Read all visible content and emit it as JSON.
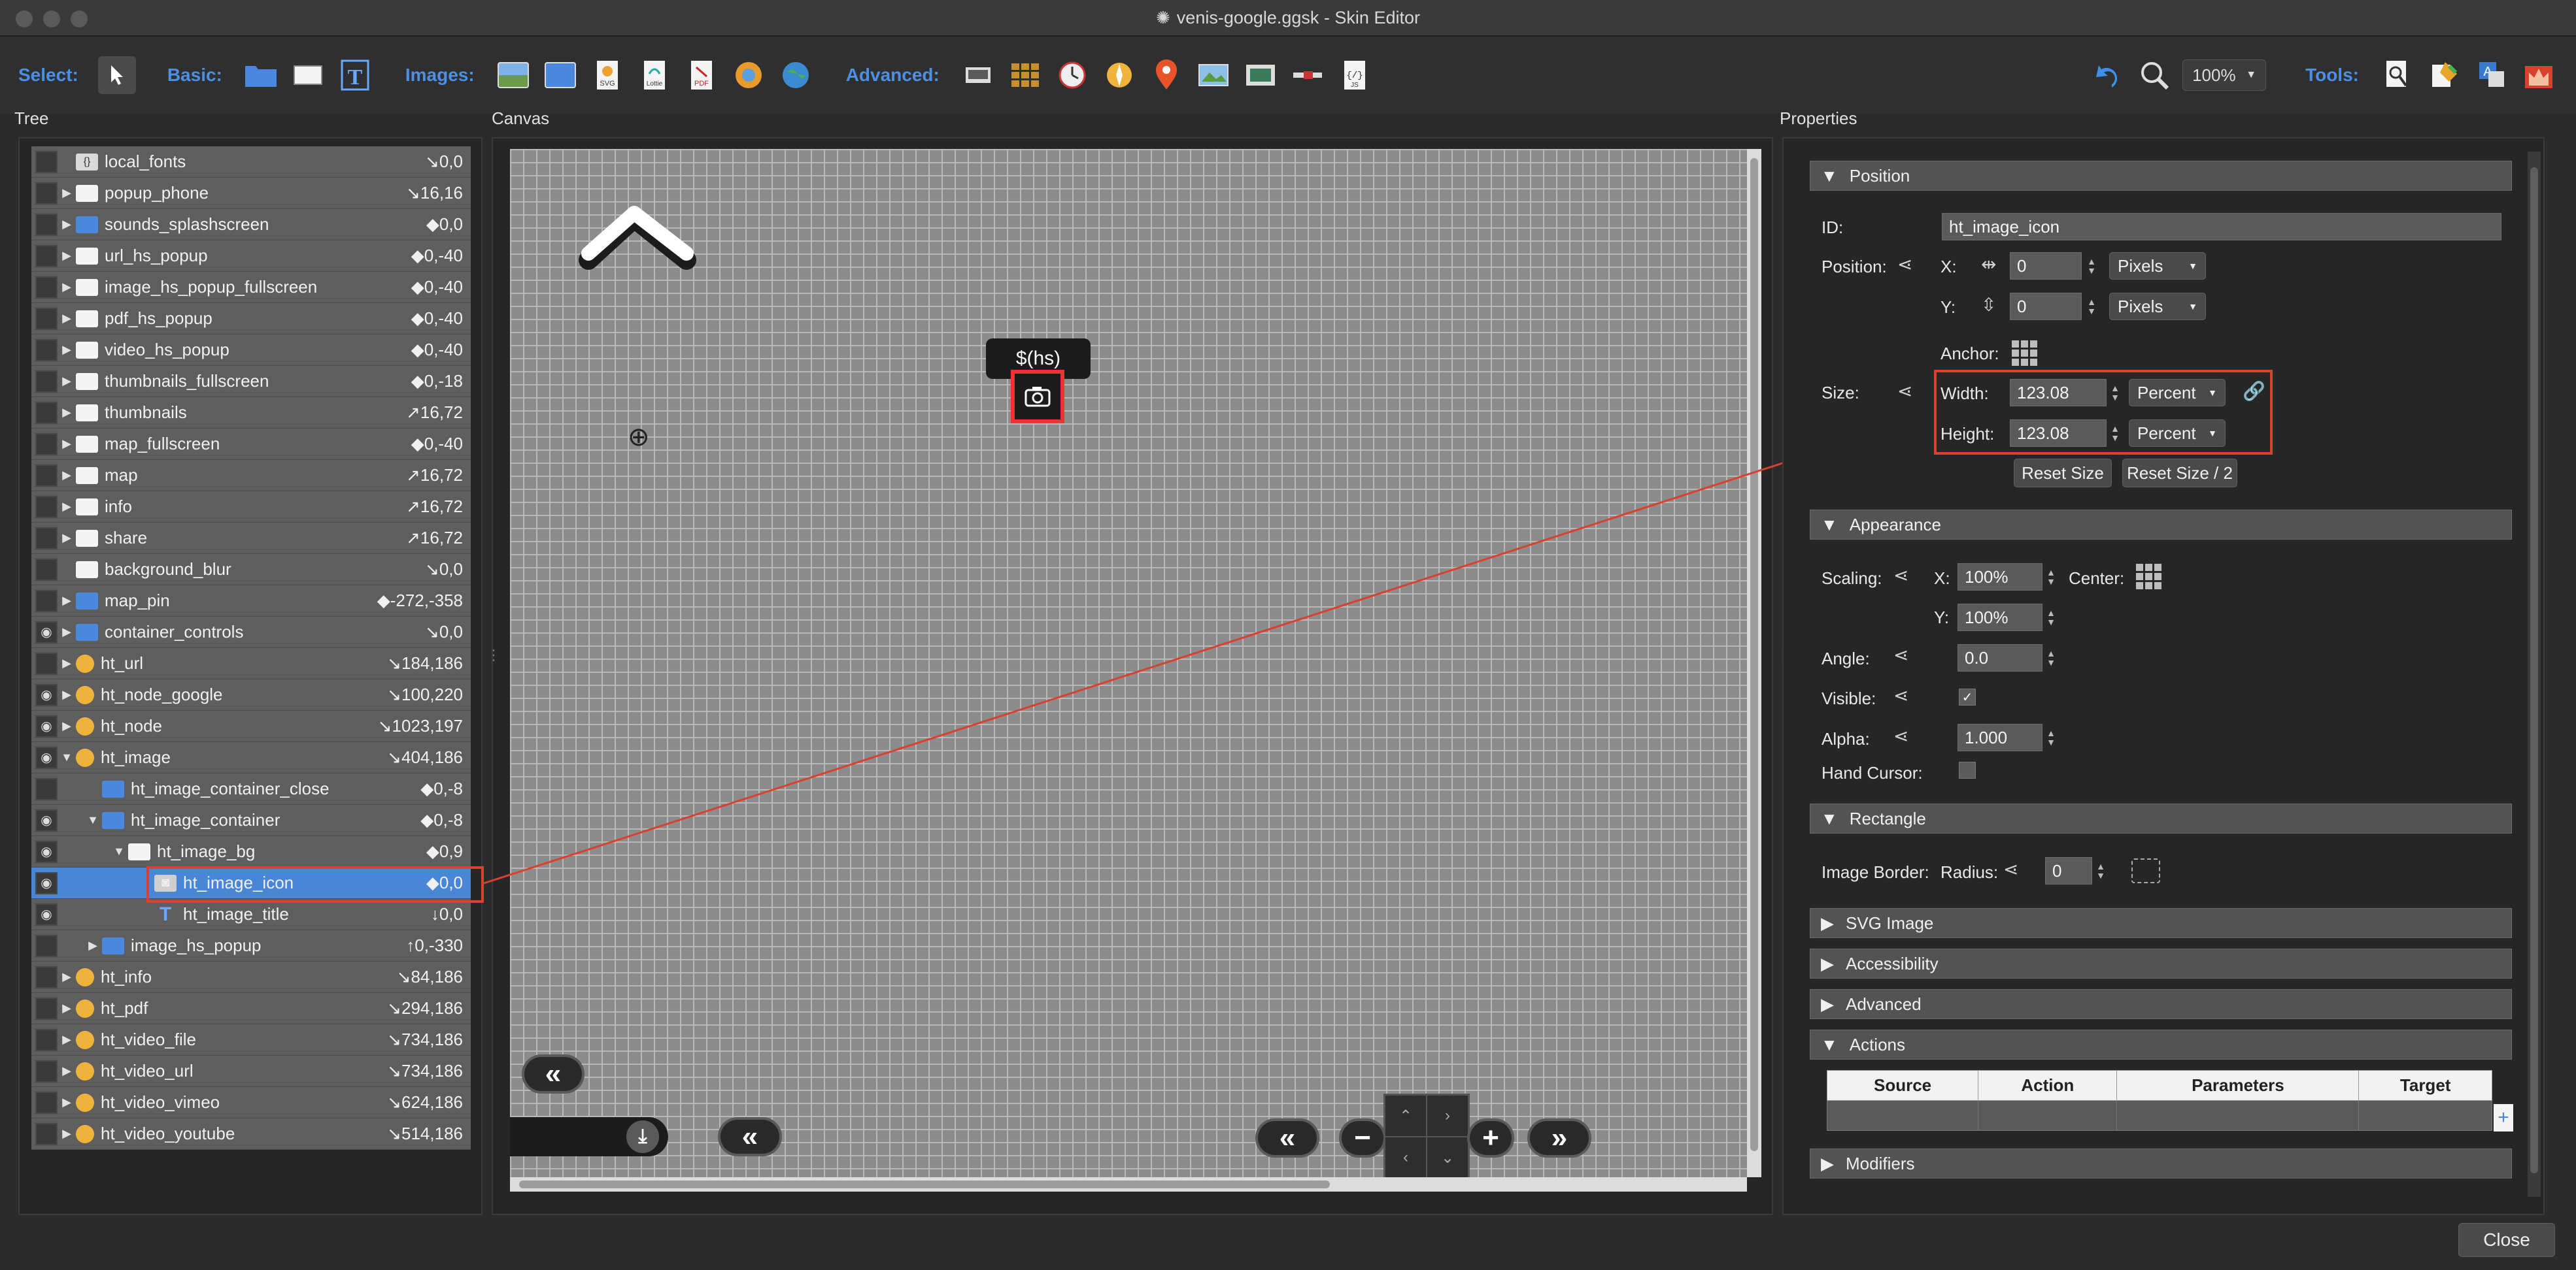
{
  "window": {
    "title": "venis-google.ggsk - Skin Editor"
  },
  "toolbar": {
    "select_label": "Select:",
    "basic_label": "Basic:",
    "images_label": "Images:",
    "advanced_label": "Advanced:",
    "tools_label": "Tools:",
    "zoom": "100%",
    "svg_badge": "SVG",
    "lottie_badge": "Lottie",
    "pdf_badge": "PDF",
    "js_badge": "JS"
  },
  "sections": {
    "tree": "Tree",
    "canvas": "Canvas",
    "properties": "Properties"
  },
  "tree": {
    "rows": [
      {
        "name": "local_fonts",
        "pos": "↘0,0",
        "type": "code",
        "eye": false,
        "arrow": "",
        "indent": 0
      },
      {
        "name": "popup_phone",
        "pos": "↘16,16",
        "type": "rect",
        "eye": false,
        "arrow": "▶",
        "indent": 0
      },
      {
        "name": "sounds_splashscreen",
        "pos": "◆0,0",
        "type": "container",
        "eye": false,
        "arrow": "▶",
        "indent": 0
      },
      {
        "name": "url_hs_popup",
        "pos": "◆0,-40",
        "type": "rect",
        "eye": false,
        "arrow": "▶",
        "indent": 0
      },
      {
        "name": "image_hs_popup_fullscreen",
        "pos": "◆0,-40",
        "type": "rect",
        "eye": false,
        "arrow": "▶",
        "indent": 0
      },
      {
        "name": "pdf_hs_popup",
        "pos": "◆0,-40",
        "type": "rect",
        "eye": false,
        "arrow": "▶",
        "indent": 0
      },
      {
        "name": "video_hs_popup",
        "pos": "◆0,-40",
        "type": "rect",
        "eye": false,
        "arrow": "▶",
        "indent": 0
      },
      {
        "name": "thumbnails_fullscreen",
        "pos": "◆0,-18",
        "type": "rect",
        "eye": false,
        "arrow": "▶",
        "indent": 0
      },
      {
        "name": "thumbnails",
        "pos": "↗16,72",
        "type": "rect",
        "eye": false,
        "arrow": "▶",
        "indent": 0
      },
      {
        "name": "map_fullscreen",
        "pos": "◆0,-40",
        "type": "rect",
        "eye": false,
        "arrow": "▶",
        "indent": 0
      },
      {
        "name": "map",
        "pos": "↗16,72",
        "type": "rect",
        "eye": false,
        "arrow": "▶",
        "indent": 0
      },
      {
        "name": "info",
        "pos": "↗16,72",
        "type": "rect",
        "eye": false,
        "arrow": "▶",
        "indent": 0
      },
      {
        "name": "share",
        "pos": "↗16,72",
        "type": "rect",
        "eye": false,
        "arrow": "▶",
        "indent": 0
      },
      {
        "name": "background_blur",
        "pos": "↘0,0",
        "type": "rect",
        "eye": false,
        "arrow": "",
        "indent": 0
      },
      {
        "name": "map_pin",
        "pos": "◆-272,-358",
        "type": "container",
        "eye": false,
        "arrow": "▶",
        "indent": 0
      },
      {
        "name": "container_controls",
        "pos": "↘0,0",
        "type": "container",
        "eye": true,
        "arrow": "▶",
        "indent": 0
      },
      {
        "name": "ht_url",
        "pos": "↘184,186",
        "type": "hotspot",
        "eye": false,
        "arrow": "▶",
        "indent": 0
      },
      {
        "name": "ht_node_google",
        "pos": "↘100,220",
        "type": "hotspot",
        "eye": true,
        "arrow": "▶",
        "indent": 0
      },
      {
        "name": "ht_node",
        "pos": "↘1023,197",
        "type": "hotspot",
        "eye": true,
        "arrow": "▶",
        "indent": 0
      },
      {
        "name": "ht_image",
        "pos": "↘404,186",
        "type": "hotspot",
        "eye": true,
        "arrow": "▼",
        "indent": 0
      },
      {
        "name": "ht_image_container_close",
        "pos": "◆0,-8",
        "type": "container",
        "eye": false,
        "arrow": "",
        "indent": 1
      },
      {
        "name": "ht_image_container",
        "pos": "◆0,-8",
        "type": "container",
        "eye": true,
        "arrow": "▼",
        "indent": 1
      },
      {
        "name": "ht_image_bg",
        "pos": "◆0,9",
        "type": "rect",
        "eye": true,
        "arrow": "▼",
        "indent": 2
      },
      {
        "name": "ht_image_icon",
        "pos": "◆0,0",
        "type": "image",
        "eye": true,
        "arrow": "",
        "indent": 3,
        "selected": true
      },
      {
        "name": "ht_image_title",
        "pos": "↓0,0",
        "type": "text",
        "eye": true,
        "arrow": "",
        "indent": 3
      },
      {
        "name": "image_hs_popup",
        "pos": "↑0,-330",
        "type": "container",
        "eye": false,
        "arrow": "▶",
        "indent": 1
      },
      {
        "name": "ht_info",
        "pos": "↘84,186",
        "type": "hotspot",
        "eye": false,
        "arrow": "▶",
        "indent": 0
      },
      {
        "name": "ht_pdf",
        "pos": "↘294,186",
        "type": "hotspot",
        "eye": false,
        "arrow": "▶",
        "indent": 0
      },
      {
        "name": "ht_video_file",
        "pos": "↘734,186",
        "type": "hotspot",
        "eye": false,
        "arrow": "▶",
        "indent": 0
      },
      {
        "name": "ht_video_url",
        "pos": "↘734,186",
        "type": "hotspot",
        "eye": false,
        "arrow": "▶",
        "indent": 0
      },
      {
        "name": "ht_video_vimeo",
        "pos": "↘624,186",
        "type": "hotspot",
        "eye": false,
        "arrow": "▶",
        "indent": 0
      },
      {
        "name": "ht_video_youtube",
        "pos": "↘514,186",
        "type": "hotspot",
        "eye": false,
        "arrow": "▶",
        "indent": 0
      }
    ]
  },
  "canvas": {
    "tooltip_text": "$(hs)"
  },
  "properties": {
    "position": {
      "header": "Position",
      "id_label": "ID:",
      "id_value": "ht_image_icon",
      "position_label": "Position:",
      "x_label": "X:",
      "x_value": "0",
      "x_unit": "Pixels",
      "y_label": "Y:",
      "y_value": "0",
      "y_unit": "Pixels",
      "anchor_label": "Anchor:",
      "size_label": "Size:",
      "width_label": "Width:",
      "width_value": "123.08",
      "width_unit": "Percent",
      "height_label": "Height:",
      "height_value": "123.08",
      "height_unit": "Percent",
      "reset_size": "Reset Size",
      "reset_size_half": "Reset Size / 2"
    },
    "appearance": {
      "header": "Appearance",
      "scaling_label": "Scaling:",
      "scale_x_label": "X:",
      "scale_x": "100%",
      "scale_y_label": "Y:",
      "scale_y": "100%",
      "center_label": "Center:",
      "angle_label": "Angle:",
      "angle": "0.0",
      "visible_label": "Visible:",
      "visible": true,
      "alpha_label": "Alpha:",
      "alpha": "1.000",
      "hand_cursor_label": "Hand Cursor:",
      "hand_cursor": false
    },
    "rectangle": {
      "header": "Rectangle",
      "image_border_label": "Image Border:",
      "radius_label": "Radius:",
      "radius": "0"
    },
    "collapsed_sections": [
      "SVG Image",
      "Accessibility",
      "Advanced"
    ],
    "actions": {
      "header": "Actions",
      "columns": [
        "Source",
        "Action",
        "Parameters",
        "Target"
      ]
    },
    "modifiers_header": "Modifiers"
  },
  "footer": {
    "close": "Close"
  },
  "colors": {
    "accent": "#4c8fe6",
    "selection": "#4a86d6",
    "highlight_red": "#d9412f"
  }
}
